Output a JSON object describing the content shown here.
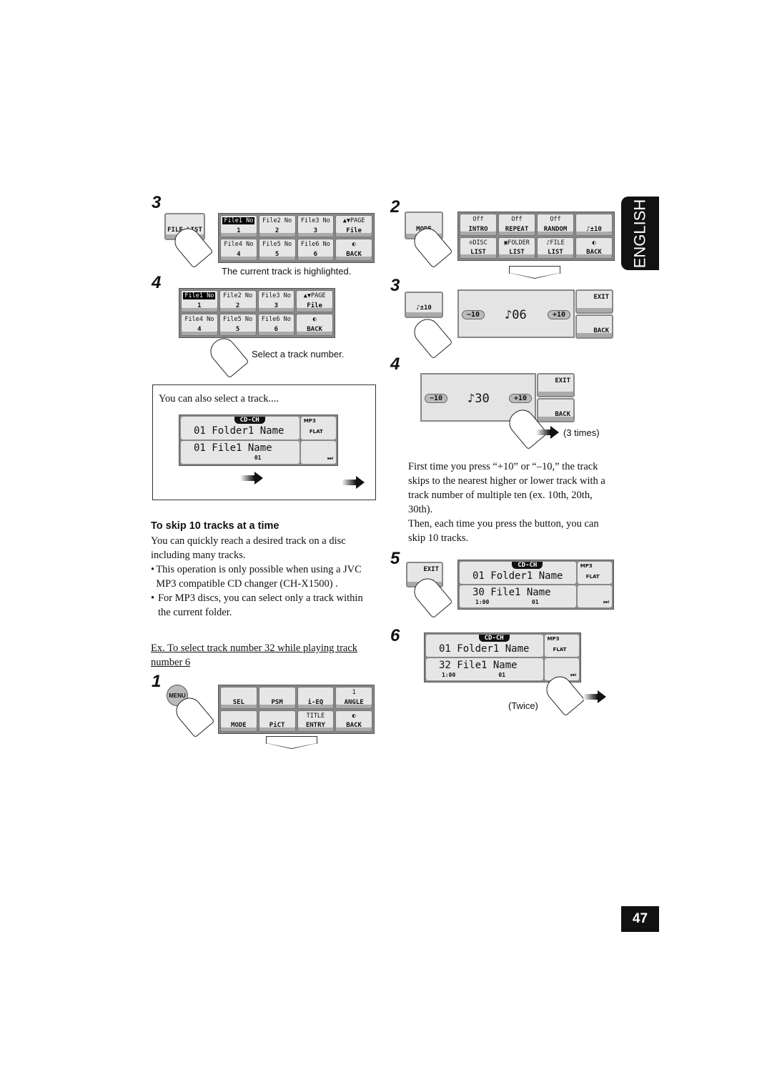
{
  "language_tab": "ENGLISH",
  "page_number": "47",
  "left": {
    "s3": {
      "step": "3",
      "button": "FILE LIST",
      "grid": [
        {
          "t": "File1 No",
          "b": "1",
          "hl": true
        },
        {
          "t": "File2 No",
          "b": "2"
        },
        {
          "t": "File3 No",
          "b": "3"
        },
        {
          "t": "▲▼PAGE",
          "b": "File"
        },
        {
          "t": "File4 No",
          "b": "4"
        },
        {
          "t": "File5 No",
          "b": "5"
        },
        {
          "t": "File6 No",
          "b": "6"
        },
        {
          "t": "◐",
          "b": "BACK"
        }
      ],
      "caption": "The current track is highlighted."
    },
    "s4": {
      "step": "4",
      "grid": [
        {
          "t": "File1 No",
          "b": "1",
          "hl": true
        },
        {
          "t": "File2 No",
          "b": "2"
        },
        {
          "t": "File3 No",
          "b": "3"
        },
        {
          "t": "▲▼PAGE",
          "b": "File"
        },
        {
          "t": "File4 No",
          "b": "4"
        },
        {
          "t": "File5 No",
          "b": "5"
        },
        {
          "t": "File6 No",
          "b": "6"
        },
        {
          "t": "◐",
          "b": "BACK"
        }
      ],
      "caption": "Select a track number."
    },
    "box": {
      "title": "You can also select a track....",
      "display": {
        "source": "CD-CH",
        "folder": "01 Folder1 Name",
        "track": "01 File1 Name",
        "mp3": "MP3",
        "eq": "FLAT",
        "disc": "01"
      }
    },
    "heading": "To skip 10 tracks at a time",
    "intro": "You can quickly reach a desired track on a disc including many tracks.",
    "bullets": [
      "This operation is only possible when using a JVC MP3 compatible CD changer (CH-X1500) .",
      "For MP3 discs, you can select only a track within the current folder."
    ],
    "example": "Ex. To select track number 32 while playing track number 6",
    "s1": {
      "step": "1",
      "button": "MENU",
      "grid": [
        {
          "t": "",
          "b": "SEL"
        },
        {
          "t": "",
          "b": "PSM"
        },
        {
          "t": "",
          "b": "i-EQ"
        },
        {
          "t": "1",
          "b": "ANGLE"
        },
        {
          "t": "",
          "b": "MODE"
        },
        {
          "t": "",
          "b": "PiCT"
        },
        {
          "t": "TITLE",
          "b": "ENTRY"
        },
        {
          "t": "◐",
          "b": "BACK"
        }
      ]
    }
  },
  "right": {
    "s2": {
      "step": "2",
      "button": "MODE",
      "grid": [
        {
          "t": "Off",
          "b": "INTRO"
        },
        {
          "t": "Off",
          "b": "REPEAT"
        },
        {
          "t": "Off",
          "b": "RANDOM"
        },
        {
          "t": "",
          "b": "♪±10"
        },
        {
          "t": "⊘DISC",
          "b": "LIST"
        },
        {
          "t": "▣FOLDER",
          "b": "LIST"
        },
        {
          "t": "♪FILE",
          "b": "LIST"
        },
        {
          "t": "◐",
          "b": "BACK"
        }
      ]
    },
    "s3": {
      "step": "3",
      "button": "♪±10",
      "minus": "−10",
      "plus": "+10",
      "value": "♪06",
      "exit": "EXIT",
      "back": "BACK"
    },
    "s4": {
      "step": "4",
      "minus": "−10",
      "plus": "+10",
      "value": "♪30",
      "exit": "EXIT",
      "back": "BACK",
      "note": "(3 times)"
    },
    "para1": "First time you press “+10” or “–10,” the track skips to the nearest higher or lower track with a track number of multiple ten (ex. 10th, 20th, 30th).",
    "para2": "Then, each time you press the button, you can skip 10 tracks.",
    "s5": {
      "step": "5",
      "button": "EXIT",
      "display": {
        "source": "CD-CH",
        "folder": "01 Folder1 Name",
        "track": "30 File1 Name",
        "time": "1:00",
        "mp3": "MP3",
        "eq": "FLAT",
        "disc": "01"
      }
    },
    "s6": {
      "step": "6",
      "display": {
        "source": "CD-CH",
        "folder": "01 Folder1 Name",
        "track": "32 File1 Name",
        "time": "1:00",
        "mp3": "MP3",
        "eq": "FLAT",
        "disc": "01"
      },
      "note": "(Twice)"
    }
  }
}
